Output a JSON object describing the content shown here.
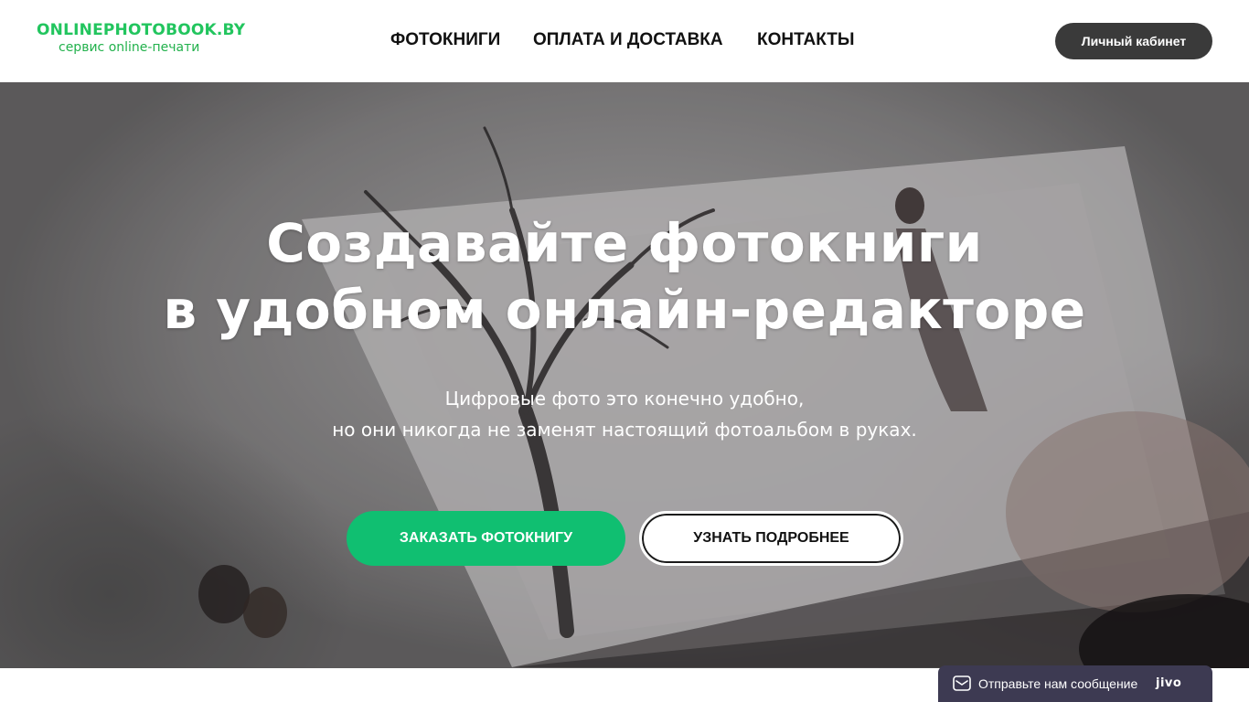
{
  "header": {
    "logo_main": "ONLINEPHOTOBOOK.BY",
    "logo_sub": "сервис online-печати",
    "nav": [
      "ФОТОКНИГИ",
      "ОПЛАТА И ДОСТАВКА",
      "КОНТАКТЫ"
    ],
    "cabinet_label": "Личный кабинет"
  },
  "hero": {
    "title_line1": "Создавайте фотокниги",
    "title_line2": "в удобном онлайн-редакторе",
    "subtitle_line1": "Цифровые фото это конечно удобно,",
    "subtitle_line2": "но они никогда не заменят настоящий фотоальбом в руках.",
    "order_button": "ЗАКАЗАТЬ ФОТОКНИГУ",
    "more_button": "УЗНАТЬ ПОДРОБНЕЕ"
  },
  "chat": {
    "label": "Отправьте нам сообщение",
    "brand": "jivo",
    "icon": "mail-icon"
  },
  "colors": {
    "logo_green": "#22c55e",
    "accent_green": "#10bf71",
    "cabinet_bg": "#3a3a3a",
    "chat_bg": "#3d3a52"
  }
}
